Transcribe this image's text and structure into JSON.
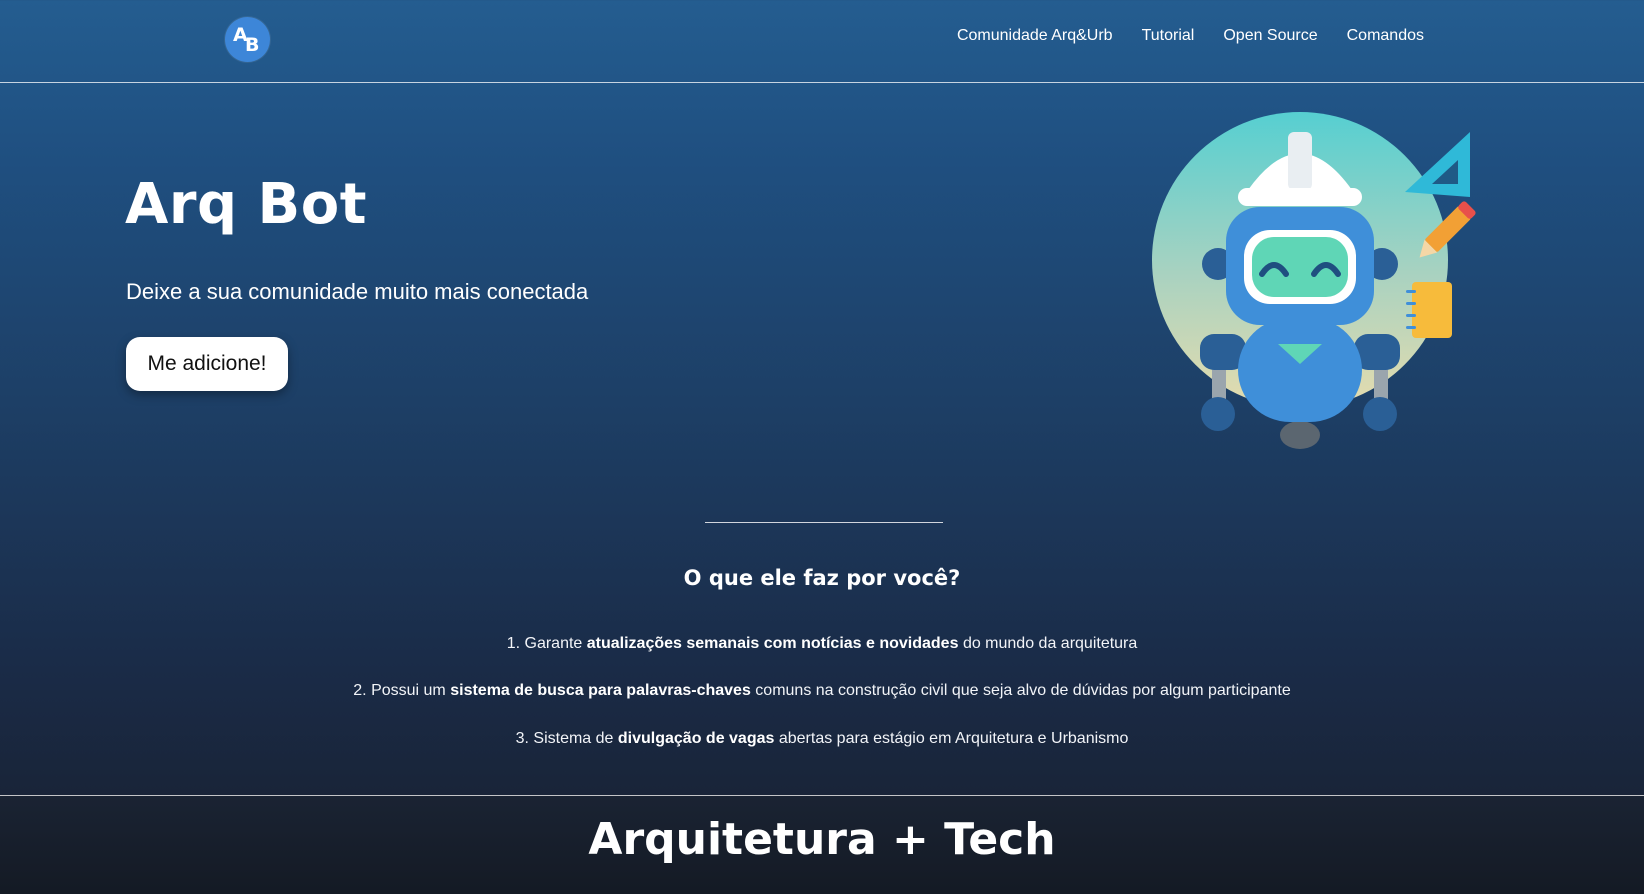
{
  "nav": {
    "logo_text": "AB",
    "links": [
      "Comunidade Arq&Urb",
      "Tutorial",
      "Open Source",
      "Comandos"
    ]
  },
  "hero": {
    "title": "Arq Bot",
    "subtitle": "Deixe a sua comunidade muito mais conectada",
    "cta_label": "Me adicione!"
  },
  "features": {
    "title": "O que ele faz por você?",
    "items": [
      {
        "number": "1.",
        "before": "Garante",
        "bold": "atualizações semanais com notícias e novidades",
        "after": "do mundo da arquitetura"
      },
      {
        "number": "2.",
        "before": "Possui um",
        "bold": "sistema de busca para palavras-chaves",
        "after": "comuns na construção civil que seja alvo de dúvidas por algum participante"
      },
      {
        "number": "3.",
        "before": "Sistema de",
        "bold": "divulgação de vagas",
        "after": "abertas para estágio em Arquitetura e Urbanismo"
      }
    ]
  },
  "footer": {
    "title": "Arquitetura + Tech"
  },
  "colors": {
    "logo_bg": "#3d86d8",
    "robot_body": "#3f8fd9",
    "robot_face": "#5fd6b6",
    "cta_bg": "#ffffff"
  },
  "icons": [
    "robot-mascot-icon",
    "set-square-icon",
    "pencil-icon",
    "notebook-icon"
  ]
}
